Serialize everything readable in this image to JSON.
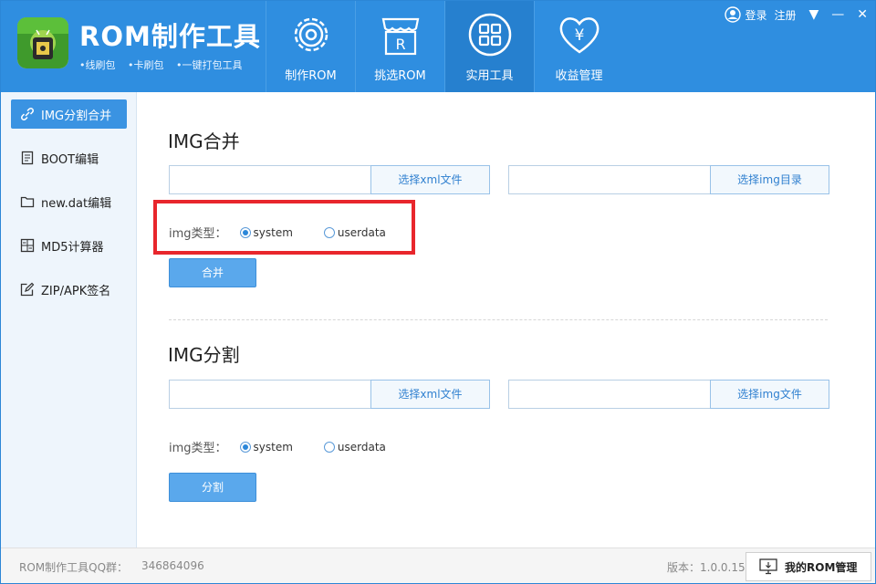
{
  "header": {
    "title": "ROM制作工具",
    "subtitle_items": [
      "•线刷包",
      "•卡刷包",
      "•一键打包工具"
    ],
    "login": "登录",
    "register": "注册",
    "nav": [
      {
        "label": "制作ROM",
        "icon": "gear-icon"
      },
      {
        "label": "挑选ROM",
        "icon": "store-icon"
      },
      {
        "label": "实用工具",
        "icon": "grid-icon"
      },
      {
        "label": "收益管理",
        "icon": "yen-heart-icon"
      }
    ],
    "active_nav": "实用工具"
  },
  "sidebar": {
    "items": [
      {
        "label": "IMG分割合并",
        "icon": "link-icon"
      },
      {
        "label": "BOOT编辑",
        "icon": "document-icon"
      },
      {
        "label": "new.dat编辑",
        "icon": "folder-icon"
      },
      {
        "label": "MD5计算器",
        "icon": "calculator-icon"
      },
      {
        "label": "ZIP/APK签名",
        "icon": "edit-icon"
      }
    ]
  },
  "merge": {
    "title": "IMG合并",
    "xml_input_value": "",
    "xml_button": "选择xml文件",
    "img_input_value": "",
    "img_button": "选择img目录",
    "type_label": "img类型：",
    "options": [
      "system",
      "userdata"
    ],
    "selected": "system",
    "action": "合并"
  },
  "split": {
    "title": "IMG分割",
    "xml_input_value": "",
    "xml_button": "选择xml文件",
    "img_input_value": "",
    "img_button": "选择img文件",
    "type_label": "img类型：",
    "options": [
      "system",
      "userdata"
    ],
    "selected": "system",
    "action": "分割"
  },
  "footer": {
    "qq_label": "ROM制作工具QQ群：",
    "qq_number": "346864096",
    "version": "版本：1.0.0.15",
    "manager_button": "我的ROM管理"
  },
  "colors": {
    "header_bg": "#2f8ee0",
    "highlight_border": "#e8262c",
    "accent": "#3a93e2"
  }
}
